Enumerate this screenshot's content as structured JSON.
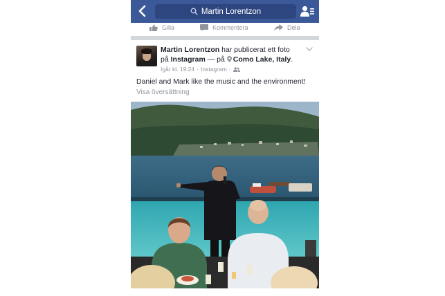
{
  "navbar": {
    "search_text": "Martin Lorentzon",
    "back_icon": "chevron-left-icon",
    "search_icon": "search-icon",
    "friends_icon": "friend-requests-icon",
    "bar_color": "#3b5998"
  },
  "actions": {
    "like_label": "Gilla",
    "comment_label": "Kommentera",
    "share_label": "Dela"
  },
  "post": {
    "author": "Martin Lorentzon",
    "published_text": " har publicerat ett foto",
    "on_text": "på ",
    "platform": "Instagram",
    "at_text": " — på ",
    "location": "Como Lake, Italy",
    "period": ".",
    "timestamp": "Igår kl. 19:24",
    "via": "Instagram",
    "message": "Daniel and Mark like the music and the environment!",
    "translate_label": "Visa översättning",
    "audience_icon": "friends-audience-icon",
    "options_icon": "chevron-down-icon"
  }
}
